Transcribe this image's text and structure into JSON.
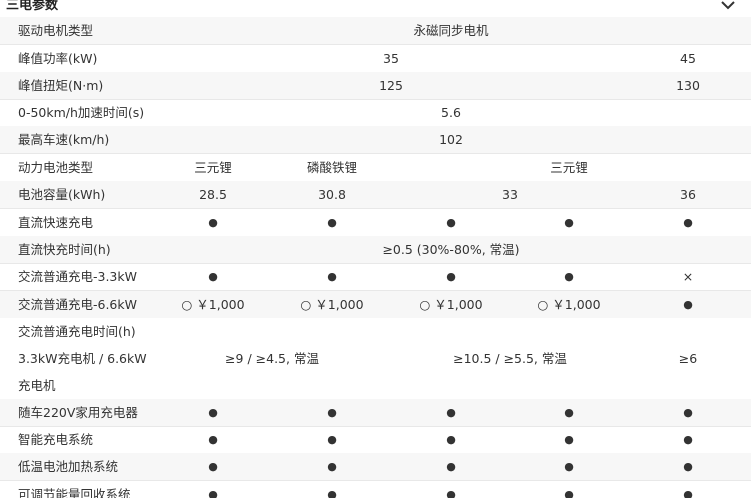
{
  "section": {
    "title": "三电参数",
    "toggle_icon": "chevron-down-icon"
  },
  "rows": {
    "motor_type": {
      "label": "驱动电机类型",
      "value": "永磁同步电机"
    },
    "peak_power": {
      "label": "峰值功率(kW)",
      "v1": "35",
      "v2": "45"
    },
    "peak_torque": {
      "label": "峰值扭矩(N·m)",
      "v1": "125",
      "v2": "130"
    },
    "accel": {
      "label": "0-50km/h加速时间(s)",
      "value": "5.6"
    },
    "top_speed": {
      "label": "最高车速(km/h)",
      "value": "102"
    },
    "battery_type": {
      "label": "动力电池类型",
      "v1": "三元锂",
      "v2": "磷酸铁锂",
      "v3": "三元锂"
    },
    "capacity": {
      "label": "电池容量(kWh)",
      "v1": "28.5",
      "v2": "30.8",
      "v3": "33",
      "v4": "36"
    },
    "dc_fast": {
      "label": "直流快速充电",
      "c1": "●",
      "c2": "●",
      "c3": "●",
      "c4": "●",
      "c5": "●"
    },
    "dc_time": {
      "label": "直流快充时间(h)",
      "value": "≥0.5 (30%-80%, 常温)"
    },
    "ac33": {
      "label": "交流普通充电-3.3kW",
      "c1": "●",
      "c2": "●",
      "c3": "●",
      "c4": "●",
      "c5": "×"
    },
    "ac66": {
      "label": "交流普通充电-6.6kW",
      "c1": "○ ￥1,000",
      "c2": "○ ￥1,000",
      "c3": "○ ￥1,000",
      "c4": "○ ￥1,000",
      "c5": "●"
    },
    "ac_time": {
      "label_line1": "交流普通充电时间(h)",
      "label_line2": "3.3kW充电机 / 6.6kW",
      "label_line3": "充电机",
      "v1": "≥9 / ≥4.5, 常温",
      "v2": "≥10.5 / ≥5.5, 常温",
      "v3": "≥6"
    },
    "charger220": {
      "label": "随车220V家用充电器",
      "c1": "●",
      "c2": "●",
      "c3": "●",
      "c4": "●",
      "c5": "●"
    },
    "smart": {
      "label": "智能充电系统",
      "c1": "●",
      "c2": "●",
      "c3": "●",
      "c4": "●",
      "c5": "●"
    },
    "heating": {
      "label": "低温电池加热系统",
      "c1": "●",
      "c2": "●",
      "c3": "●",
      "c4": "●",
      "c5": "●"
    },
    "regen": {
      "label": "可调节能量回收系统",
      "c1": "●",
      "c2": "●",
      "c3": "●",
      "c4": "●",
      "c5": "●"
    }
  }
}
